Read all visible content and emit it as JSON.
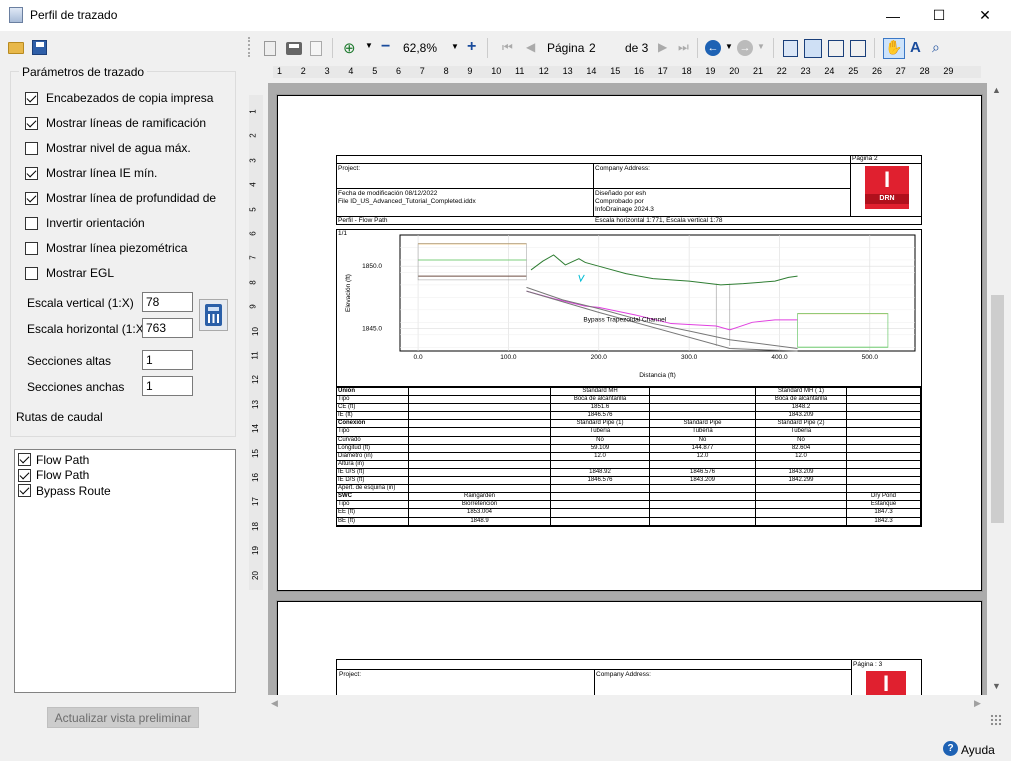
{
  "window": {
    "title": "Perfil de trazado",
    "minimize": "—",
    "maximize": "☐",
    "close": "✕"
  },
  "params": {
    "group_title": "Parámetros de trazado",
    "checks": [
      {
        "label": "Encabezados de copia impresa",
        "checked": true
      },
      {
        "label": "Mostrar líneas de ramificación",
        "checked": true
      },
      {
        "label": "Mostrar nivel de agua máx.",
        "checked": false
      },
      {
        "label": "Mostrar línea IE mín.",
        "checked": true
      },
      {
        "label": "Mostrar línea de profundidad de",
        "checked": true
      },
      {
        "label": "Invertir orientación",
        "checked": false
      },
      {
        "label": "Mostrar línea piezométrica",
        "checked": false
      },
      {
        "label": "Mostrar EGL",
        "checked": false
      }
    ],
    "vscale_label": "Escala vertical (1:X)",
    "vscale": "78",
    "hscale_label": "Escala horizontal (1:X)",
    "hscale": "763",
    "tall_label": "Secciones altas",
    "tall": "1",
    "wide_label": "Secciones anchas",
    "wide": "1"
  },
  "routes": {
    "title": "Rutas de caudal",
    "items": [
      {
        "label": "Flow Path",
        "checked": true
      },
      {
        "label": "Flow Path",
        "checked": true
      },
      {
        "label": "Bypass Route",
        "checked": true
      }
    ]
  },
  "update_button": "Actualizar vista preliminar",
  "help_link": "Ayuda",
  "toolbar": {
    "zoom": "62,8%",
    "page_label": "Página",
    "page": "2",
    "of_label": "de 3"
  },
  "hruler": [
    "1",
    "2",
    "3",
    "4",
    "5",
    "6",
    "7",
    "8",
    "9",
    "10",
    "11",
    "12",
    "13",
    "14",
    "15",
    "16",
    "17",
    "18",
    "19",
    "20",
    "21",
    "22",
    "23",
    "24",
    "25",
    "26",
    "27",
    "28",
    "29"
  ],
  "vruler": [
    "1",
    "2",
    "3",
    "4",
    "5",
    "6",
    "7",
    "8",
    "9",
    "10",
    "11",
    "12",
    "13",
    "14",
    "15",
    "16",
    "17",
    "18",
    "19",
    "20"
  ],
  "report": {
    "project": "Project:",
    "company": "Company Address:",
    "page_no": "Página 2",
    "page_no2": "Página : 3",
    "modified": "Fecha de modificación 08/12/2022",
    "file": "File ID_US_Advanced_Tutorial_Completed.iddx",
    "designed": "Diseñado por esh",
    "checked": "Comprobado por",
    "software": "InfoDrainage 2024.3",
    "profile": "Perfil - Flow Path",
    "scale": "Escala horizontal  1:771, Escala vertical 1:78",
    "logo_letter": "I",
    "logo_text": "DRN",
    "sheet": "1/1"
  },
  "chart_data": {
    "type": "line",
    "xlabel": "Distancia (ft)",
    "ylabel": "Elevación (ft)",
    "x_ticks": [
      "0.0",
      "100.0",
      "200.0",
      "300.0",
      "400.0",
      "500.0"
    ],
    "y_ticks": [
      "1850.0",
      "1845.0"
    ],
    "xlim": [
      -20,
      550
    ],
    "ylim": [
      1843.2,
      1852.5
    ],
    "annotation": "Bypass Trapezoidal Channel",
    "series": [
      {
        "color": "#2e7d32",
        "points": [
          [
            125,
            1849.7
          ],
          [
            138,
            1850.4
          ],
          [
            150,
            1850.9
          ],
          [
            163,
            1850.1
          ],
          [
            178,
            1850.6
          ],
          [
            185,
            1850.3
          ],
          [
            200,
            1850.0
          ],
          [
            230,
            1849.4
          ],
          [
            260,
            1849.0
          ],
          [
            300,
            1848.8
          ],
          [
            335,
            1848.5
          ],
          [
            360,
            1848.6
          ],
          [
            395,
            1848.8
          ],
          [
            410,
            1849.1
          ],
          [
            420,
            1849.2
          ]
        ]
      },
      {
        "color": "#e040e0",
        "points": [
          [
            120,
            1848.0
          ],
          [
            150,
            1847.4
          ],
          [
            185,
            1846.8
          ],
          [
            200,
            1846.7
          ],
          [
            240,
            1846.1
          ],
          [
            280,
            1845.4
          ],
          [
            330,
            1845.2
          ],
          [
            345,
            1844.9
          ],
          [
            370,
            1845.5
          ],
          [
            395,
            1845.7
          ],
          [
            420,
            1845.7
          ]
        ]
      },
      {
        "color": "#777777",
        "points": [
          [
            120,
            1848.3
          ],
          [
            160,
            1847.3
          ],
          [
            200,
            1846.6
          ],
          [
            260,
            1845.4
          ],
          [
            300,
            1844.8
          ],
          [
            345,
            1844.1
          ],
          [
            420,
            1843.4
          ]
        ]
      },
      {
        "color": "#777777",
        "points": [
          [
            120,
            1848.0
          ],
          [
            200,
            1846.3
          ],
          [
            345,
            1843.4
          ],
          [
            420,
            1843.2
          ]
        ]
      },
      {
        "color": "#00bcd4",
        "points": [
          [
            178,
            1849.3
          ],
          [
            180,
            1848.8
          ],
          [
            184,
            1849.3
          ]
        ]
      },
      {
        "color": "#e0a030",
        "points": [
          [
            0,
            1851.8
          ],
          [
            120,
            1851.8
          ]
        ]
      },
      {
        "color": "#7ecf7e",
        "points": [
          [
            0,
            1850.5
          ],
          [
            120,
            1850.5
          ]
        ]
      },
      {
        "color": "#6d4c41",
        "points": [
          [
            0,
            1849.2
          ],
          [
            120,
            1849.2
          ]
        ]
      },
      {
        "color": "#e0a030",
        "points": [
          [
            420,
            1846.2
          ],
          [
            520,
            1846.2
          ]
        ]
      },
      {
        "color": "#7ecf7e",
        "points": [
          [
            420,
            1843.5
          ],
          [
            520,
            1843.5
          ]
        ]
      }
    ]
  },
  "table": {
    "rows": [
      {
        "h": "Unión",
        "bold": true,
        "cells": [
          "",
          "Standard MH",
          "",
          "Standard MH ( 1)",
          ""
        ]
      },
      {
        "h": "Tipo",
        "cells": [
          "",
          "Boca de alcantarilla",
          "",
          "Boca de alcantarilla",
          ""
        ]
      },
      {
        "h": "CE (ft)",
        "cells": [
          "",
          "1851.6",
          "",
          "1848.2",
          ""
        ]
      },
      {
        "h": "IE (ft)",
        "cells": [
          "",
          "1846.576",
          "",
          "1843.209",
          ""
        ]
      },
      {
        "h": "Conexión",
        "bold": true,
        "cells": [
          "",
          "Standard Pipe (1)",
          "Standard Pipe",
          "Standard Pipe (2)",
          ""
        ]
      },
      {
        "h": "Tipo",
        "cells": [
          "",
          "Tubería",
          "Tubería",
          "Tubería",
          ""
        ]
      },
      {
        "h": "Curvado",
        "cells": [
          "",
          "No",
          "No",
          "No",
          ""
        ]
      },
      {
        "h": "Longitud (ft)",
        "cells": [
          "",
          "59.109",
          "144.877",
          "82.604",
          ""
        ]
      },
      {
        "h": "Diámetro (in)",
        "cells": [
          "",
          "12.0",
          "12.0",
          "12.0",
          ""
        ]
      },
      {
        "h": "Altura (in)",
        "cells": [
          "",
          "",
          "",
          "",
          ""
        ]
      },
      {
        "h": "IE U/S (ft)",
        "cells": [
          "",
          "1848.92",
          "1846.576",
          "1843.209",
          ""
        ]
      },
      {
        "h": "IE D/S (ft)",
        "cells": [
          "",
          "1846.576",
          "1843.209",
          "1842.299",
          ""
        ]
      },
      {
        "h": "Apert. de esquina (in)",
        "cells": [
          "",
          "",
          "",
          "",
          ""
        ]
      },
      {
        "h": "SWC",
        "bold": true,
        "cells": [
          "Raingarden",
          "",
          "",
          "",
          "Dry Pond"
        ]
      },
      {
        "h": "Tipo",
        "cells": [
          "Biorretención",
          "",
          "",
          "",
          "Estanque"
        ]
      },
      {
        "h": "EE (ft)",
        "cells": [
          "1853.004",
          "",
          "",
          "",
          "1847.3"
        ]
      },
      {
        "h": "BE (ft)",
        "cells": [
          "1848.9",
          "",
          "",
          "",
          "1842.3"
        ]
      }
    ]
  }
}
